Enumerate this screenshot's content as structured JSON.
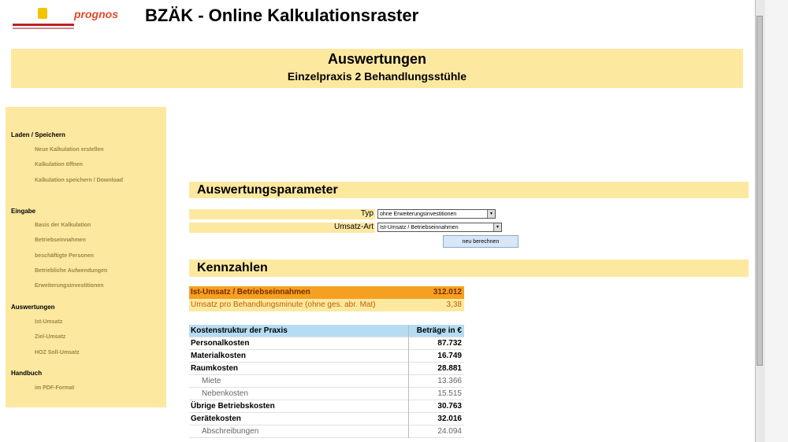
{
  "header": {
    "logo_text": "prognos",
    "title": "BZÄK - Online Kalkulationsraster"
  },
  "banner": {
    "title": "Auswertungen",
    "subtitle": "Einzelpraxis 2 Behandlungsstühle"
  },
  "sidebar": {
    "sections": [
      {
        "heading": "Laden / Speichern",
        "items": [
          "Neue Kalkulation erstellen",
          "Kalkulation öffnen",
          "Kalkulation speichern / Download"
        ]
      },
      {
        "heading": "Eingabe",
        "items": [
          "Basis der Kalkulation",
          "Betriebseinnahmen",
          "beschäftigte Personen",
          "Betriebliche Aufwendungen",
          "Erweiterungsinvestitionen"
        ]
      },
      {
        "heading": "Auswertungen",
        "items": [
          "Ist-Umsatz",
          "Ziel-Umsatz",
          "HOZ Soll-Umsatz"
        ]
      },
      {
        "heading": "Handbuch",
        "items": [
          "im PDF-Format"
        ]
      }
    ]
  },
  "params": {
    "heading": "Auswertungsparameter",
    "typ_label": "Typ",
    "typ_value": "ohne Erweiterungsinvestitionen",
    "umsatz_label": "Umsatz-Art",
    "umsatz_value": "Ist-Umsatz / Betriebseinnahmen",
    "recalc_label": "neu berechnen"
  },
  "kennzahlen": {
    "heading": "Kennzahlen",
    "row1_label": "Ist-Umsatz / Betriebseinnahmen",
    "row1_value": "312.012",
    "row2_label": "Umsatz pro Behandlungsminute (ohne ges. abr. Mat)",
    "row2_value": "3,38"
  },
  "cost_table": {
    "header_label": "Kostenstruktur der Praxis",
    "header_value": "Beträge in €",
    "rows": [
      {
        "label": "Personalkosten",
        "value": "87.732"
      },
      {
        "label": "Materialkosten",
        "value": "16.749"
      },
      {
        "label": "Raumkosten",
        "value": "28.881"
      },
      {
        "label": "Miete",
        "value": "13.366"
      },
      {
        "label": "Nebenkosten",
        "value": "15.515"
      },
      {
        "label": "Übrige Betriebskosten",
        "value": "30.763"
      },
      {
        "label": "Gerätekosten",
        "value": "32.016"
      },
      {
        "label": "Abschreibungen",
        "value": "24.094"
      }
    ]
  },
  "colors": {
    "panel": "#fde8a0",
    "kennzahl_highlight": "#f5a020",
    "kennzahl_highlight_text": "#7a2a00",
    "table_header": "#b5dcf2",
    "logo_text": "#e04a2a"
  }
}
